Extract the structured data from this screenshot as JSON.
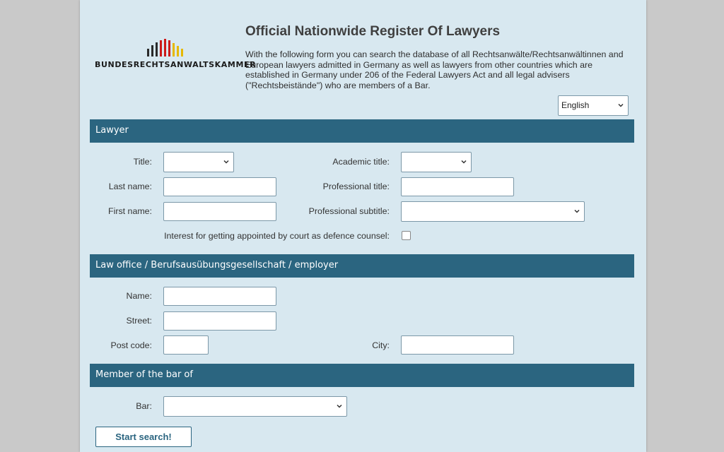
{
  "header": {
    "logo_text": "BUNDESRECHTSANWALTSKAMMER",
    "title": "Official Nationwide Register Of Lawyers",
    "intro": "With the following form you can search the database of all Rechtsanwälte/Rechtsanwältinnen and European lawyers admitted in Germany as well as lawyers from other countries which are established in Germany under 206 of the Federal Lawyers Act and all legal advisers (\"Rechtsbeistände\") who are members of a Bar.",
    "language": "English"
  },
  "lawyer": {
    "heading": "Lawyer",
    "title_label": "Title:",
    "academic_title_label": "Academic title:",
    "last_name_label": "Last name:",
    "professional_title_label": "Professional title:",
    "first_name_label": "First name:",
    "professional_subtitle_label": "Professional subtitle:",
    "defence_counsel_label": "Interest for getting appointed by court as defence counsel:"
  },
  "office": {
    "heading": "Law office / Berufsausübungsgesellschaft / employer",
    "name_label": "Name:",
    "street_label": "Street:",
    "post_code_label": "Post code:",
    "city_label": "City:"
  },
  "bar": {
    "heading": "Member of the bar of",
    "bar_label": "Bar:"
  },
  "actions": {
    "search_label": "Start search!"
  },
  "colors": {
    "page_background": "#d8e8f0",
    "section_header": "#2b6580",
    "window_background": "#c9c9c9"
  }
}
